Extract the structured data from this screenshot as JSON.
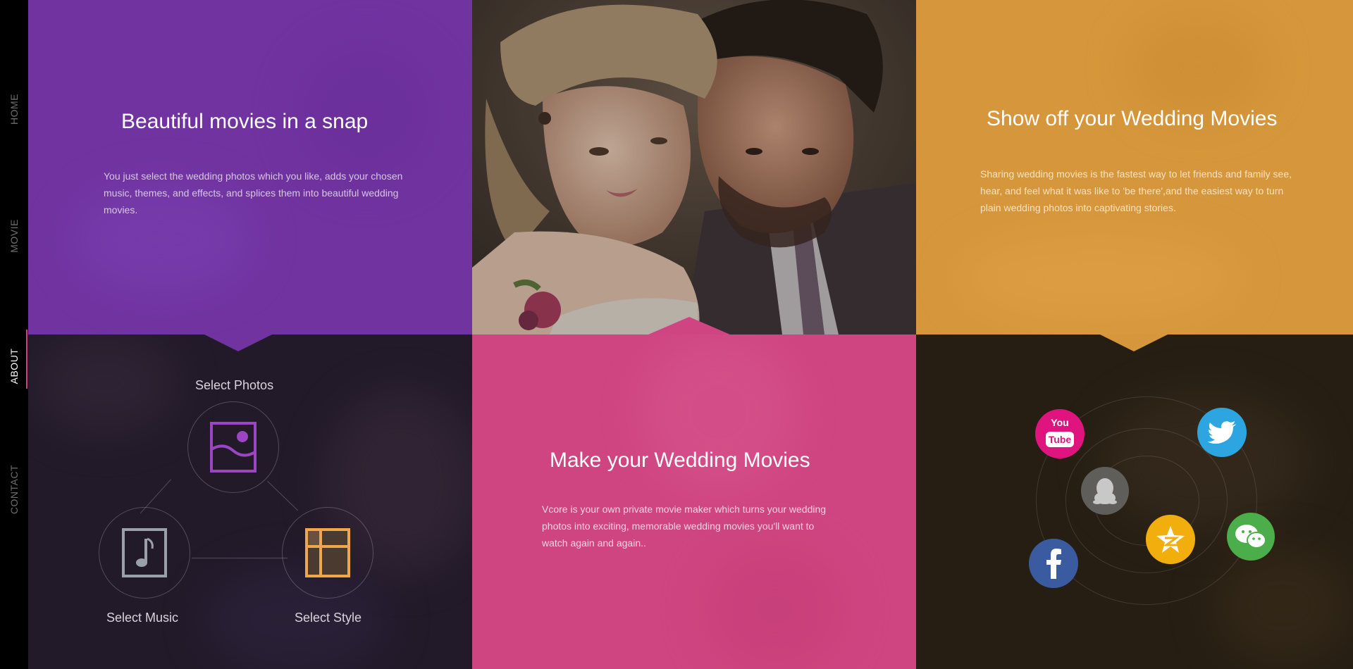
{
  "nav": {
    "items": [
      {
        "label": "HOME"
      },
      {
        "label": "MOVIE"
      },
      {
        "label": "ABOUT"
      },
      {
        "label": "CONTACT"
      }
    ],
    "active": "ABOUT"
  },
  "snap": {
    "title": "Beautiful movies in a snap",
    "body": "You just select the wedding photos which you like, adds your chosen music, themes, and effects, and splices them into beautiful wedding movies."
  },
  "showoff": {
    "title": "Show off your Wedding  Movies",
    "body": "Sharing wedding movies is the fastest way to let friends and family see, hear, and feel what it was like to 'be there',and the easiest way to turn plain wedding photos into captivating stories."
  },
  "workflow": {
    "photos_label": "Select Photos",
    "music_label": "Select Music",
    "style_label": "Select Style"
  },
  "make": {
    "title": "Make your Wedding  Movies",
    "body": "Vcore is your own private movie maker which turns your wedding photos into exciting, memorable wedding movies you'll want to watch again and again.."
  },
  "social": {
    "icons": [
      "youtube-icon",
      "twitter-icon",
      "qq-icon",
      "qzone-icon",
      "wechat-icon",
      "facebook-icon"
    ],
    "youtube_top": "You",
    "youtube_bottom": "Tube"
  },
  "colors": {
    "purple": "#7033a0",
    "orange": "#d6963b",
    "pink": "#cf4581",
    "dark": "#221a29",
    "brown": "#261e13",
    "accent": "#d9407f"
  }
}
